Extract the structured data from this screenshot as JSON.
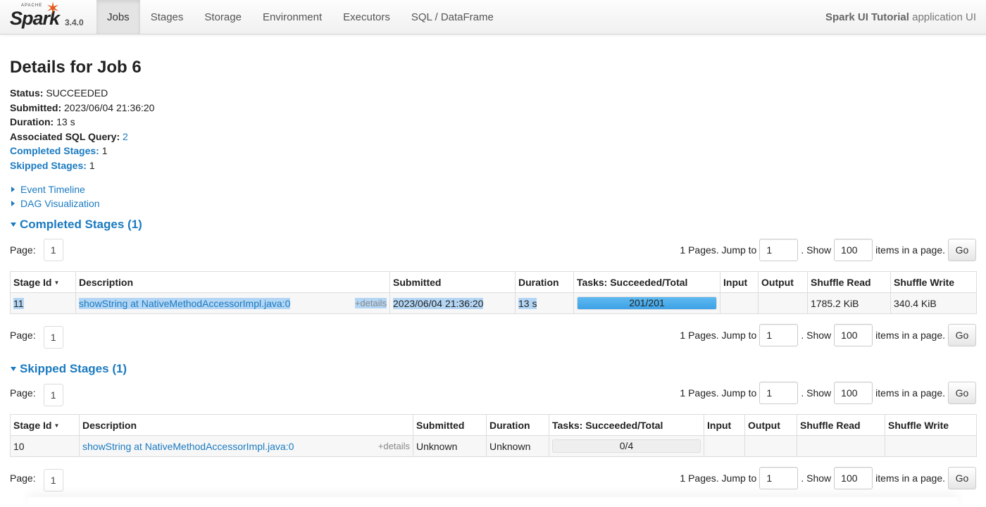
{
  "brand": {
    "apache": "APACHE",
    "name": "Spark",
    "version": "3.4.0"
  },
  "nav": {
    "tabs": [
      "Jobs",
      "Stages",
      "Storage",
      "Environment",
      "Executors",
      "SQL / DataFrame"
    ],
    "active": "Jobs",
    "app_name": "Spark UI Tutorial",
    "app_suffix": "application UI"
  },
  "job": {
    "title": "Details for Job 6",
    "status_label": "Status:",
    "status": "SUCCEEDED",
    "submitted_label": "Submitted:",
    "submitted": "2023/06/04 21:36:20",
    "duration_label": "Duration:",
    "duration": "13 s",
    "sql_label": "Associated SQL Query:",
    "sql_query": "2",
    "completed_label": "Completed Stages:",
    "completed_count": "1",
    "skipped_label": "Skipped Stages:",
    "skipped_count": "1"
  },
  "toggles": {
    "event_timeline": "Event Timeline",
    "dag": "DAG Visualization"
  },
  "pager": {
    "page_label": "Page:",
    "page": "1",
    "pages_text": "1 Pages. Jump to",
    "jump_value": "1",
    "show_text": ". Show",
    "show_value": "100",
    "items_text": "items in a page.",
    "go": "Go"
  },
  "columns": [
    "Stage Id",
    "Description",
    "Submitted",
    "Duration",
    "Tasks: Succeeded/Total",
    "Input",
    "Output",
    "Shuffle Read",
    "Shuffle Write"
  ],
  "completed": {
    "heading": "Completed Stages (1)",
    "row": {
      "stage_id": "11",
      "description": "showString at NativeMethodAccessorImpl.java:0",
      "details": "+details",
      "submitted": "2023/06/04 21:36:20",
      "duration": "13 s",
      "tasks": "201/201",
      "tasks_progress": 1.0,
      "input": "",
      "output": "",
      "shuffle_read": "1785.2 KiB",
      "shuffle_write": "340.4 KiB"
    }
  },
  "skipped": {
    "heading": "Skipped Stages (1)",
    "row": {
      "stage_id": "10",
      "description": "showString at NativeMethodAccessorImpl.java:0",
      "details": "+details",
      "submitted": "Unknown",
      "duration": "Unknown",
      "tasks": "0/4",
      "tasks_progress": 0.0,
      "input": "",
      "output": "",
      "shuffle_read": "",
      "shuffle_write": ""
    }
  },
  "colors": {
    "link": "#1a7ac0",
    "progress": "#3ea2e6",
    "spark_orange": "#e25a1c",
    "selection": "#b4d6f5"
  }
}
